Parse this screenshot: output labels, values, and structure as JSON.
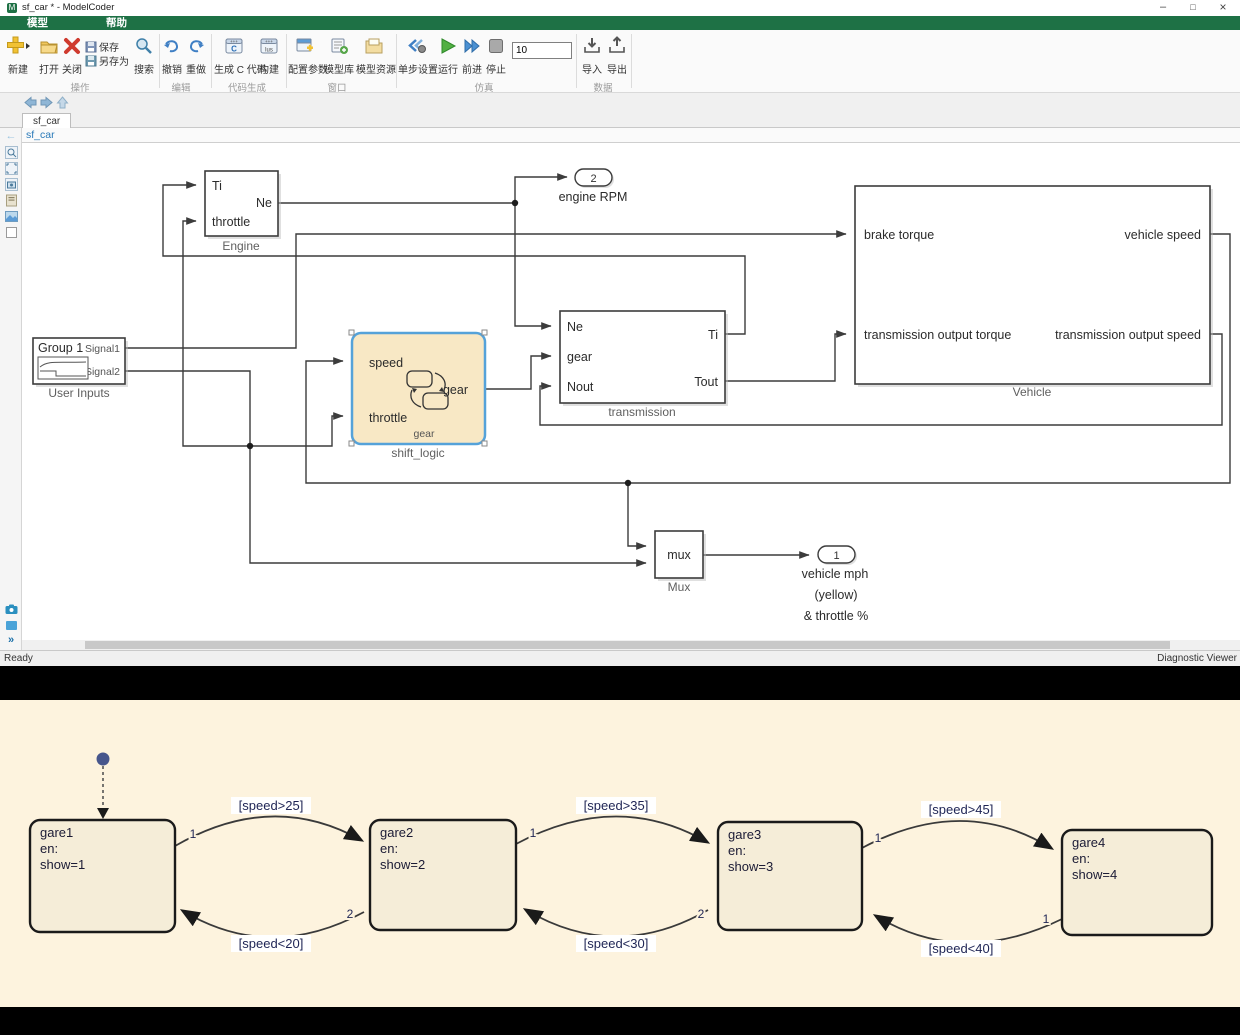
{
  "window": {
    "title": "sf_car * - ModelCoder",
    "logo": "M",
    "minimize": "–",
    "maximize": "□",
    "close": "×"
  },
  "menu": {
    "model": "模型",
    "help": "帮助"
  },
  "toolbar": {
    "new": "新建",
    "open": "打开",
    "close": "关闭",
    "save": "保存",
    "save_as": "另存为",
    "search": "搜索",
    "undo": "撤销",
    "redo": "重做",
    "gen_c": "生成 C 代码",
    "build": "构建",
    "config": "配置参数",
    "model_lib": "模型库",
    "model_res": "模型资源",
    "step_settings": "单步设置",
    "run": "运行",
    "forward": "前进",
    "stop": "停止",
    "sim_time": "10",
    "import": "导入",
    "export": "导出",
    "groups": {
      "ops": "操作",
      "edit": "编辑",
      "codegen": "代码生成",
      "window": "窗口",
      "sim": "仿真",
      "data": "数据"
    }
  },
  "tab": {
    "label": "sf_car"
  },
  "breadcrumb": {
    "label": "sf_car"
  },
  "sidebar": {
    "back": "←",
    "chevrons": "»"
  },
  "statusbar": {
    "left": "Ready",
    "right": "Diagnostic Viewer"
  },
  "diagram": {
    "engine": {
      "label": "Engine",
      "ti": "Ti",
      "throttle": "throttle",
      "ne": "Ne"
    },
    "engine_rpm": {
      "num": "2",
      "label": "engine RPM"
    },
    "user_inputs": {
      "label": "User Inputs",
      "group": "Group 1",
      "signal1": "Signal1",
      "signal2": "Signal2"
    },
    "shift_logic": {
      "label": "shift_logic",
      "speed": "speed",
      "throttle": "throttle",
      "gear": "gear",
      "sub": "gear"
    },
    "transmission": {
      "label": "transmission",
      "ne": "Ne",
      "gear": "gear",
      "nout": "Nout",
      "ti": "Ti",
      "tout": "Tout"
    },
    "vehicle": {
      "label": "Vehicle",
      "brake": "brake torque",
      "tot": "transmission output torque",
      "vs": "vehicle speed",
      "tos": "transmission output speed"
    },
    "mux": {
      "label": "Mux",
      "text": "mux"
    },
    "out1": {
      "num": "1",
      "l1": "vehicle mph",
      "l2": "(yellow)",
      "l3": "& throttle %"
    }
  },
  "statechart": {
    "s1": {
      "name": "gare1",
      "en": "en:",
      "act": "show=1"
    },
    "s2": {
      "name": "gare2",
      "en": "en:",
      "act": "show=2"
    },
    "s3": {
      "name": "gare3",
      "en": "en:",
      "act": "show=3"
    },
    "s4": {
      "name": "gare4",
      "en": "en:",
      "act": "show=4"
    },
    "t12": {
      "label": "[speed>25]",
      "n": "1"
    },
    "t21": {
      "label": "[speed<20]",
      "n": "2"
    },
    "t23": {
      "label": "[speed>35]",
      "n": "1"
    },
    "t32": {
      "label": "[speed<30]",
      "n": "2"
    },
    "t34": {
      "label": "[speed>45]",
      "n": "1"
    },
    "t43": {
      "label": "[speed<40]",
      "n": "1"
    }
  },
  "colors": {
    "ribbon_green": "#1E7145",
    "selection_blue": "#55A2D9",
    "shift_fill": "#F8E8C5",
    "state_bg": "#FDF3DE",
    "state_fill": "#F5EDD8",
    "wire": "#3c3c3c",
    "navy": "#1e2454"
  }
}
